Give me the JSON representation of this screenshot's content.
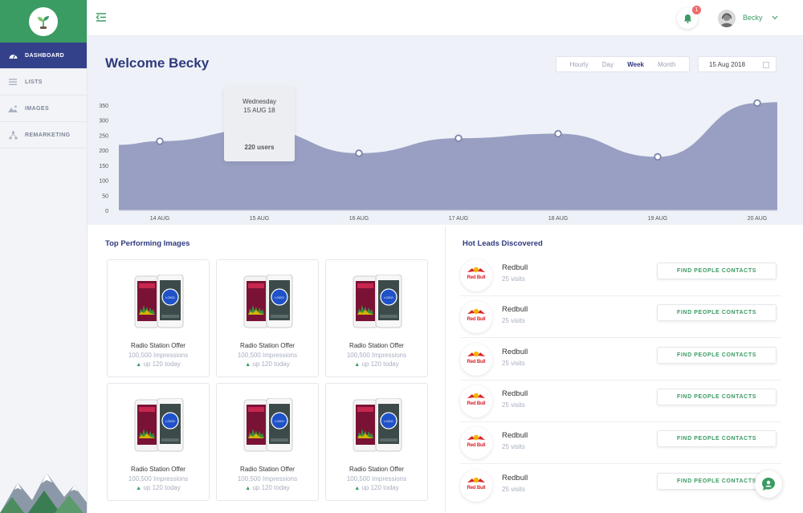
{
  "sidebar": {
    "items": [
      {
        "label": "DASHBOARD",
        "icon": "dashboard-icon",
        "active": true
      },
      {
        "label": "LISTS",
        "icon": "list-icon",
        "active": false
      },
      {
        "label": "IMAGES",
        "icon": "images-icon",
        "active": false
      },
      {
        "label": "REMARKETING",
        "icon": "remarketing-icon",
        "active": false
      }
    ]
  },
  "header": {
    "notification_count": "1",
    "user_name": "Becky"
  },
  "dashboard": {
    "welcome": "Welcome Becky",
    "range_tabs": [
      "Hourly",
      "Day",
      "Week",
      "Month"
    ],
    "active_range": "Week",
    "date": "15 Aug 2018"
  },
  "tooltip": {
    "day": "Wednesday",
    "date": "15 AUG 18",
    "value": "220 users"
  },
  "chart_data": {
    "type": "area",
    "categories": [
      "14 AUG",
      "15 AUG",
      "16 AUG",
      "17 AUG",
      "18 AUG",
      "19 AUG",
      "20 AUG"
    ],
    "values": [
      230,
      270,
      190,
      240,
      255,
      178,
      357
    ],
    "ylim": [
      0,
      350
    ],
    "yticks": [
      0,
      50,
      100,
      150,
      200,
      250,
      300,
      350
    ],
    "grid": false,
    "color": "#8a91b8"
  },
  "top_images": {
    "title": "Top Performing Images",
    "cards": [
      {
        "title": "Radio Station Offer",
        "impressions": "100,500 Impressions",
        "trend": "up 120 today"
      },
      {
        "title": "Radio Station Offer",
        "impressions": "100,500 Impressions",
        "trend": "up 120 today"
      },
      {
        "title": "Radio Station Offer",
        "impressions": "100,500 Impressions",
        "trend": "up 120 today"
      },
      {
        "title": "Radio Station Offer",
        "impressions": "100,500 Impressions",
        "trend": "up 120 today"
      },
      {
        "title": "Radio Station Offer",
        "impressions": "100,500 Impressions",
        "trend": "up 120 today"
      },
      {
        "title": "Radio Station Offer",
        "impressions": "100,500 Impressions",
        "trend": "up 120 today"
      }
    ],
    "phone_logo_text": "LOGO"
  },
  "hot_leads": {
    "title": "Hot Leads Discovered",
    "button_label": "FIND PEOPLE CONTACTS",
    "logo_text": "Red Bull",
    "leads": [
      {
        "name": "Redbull",
        "visits": "25 visits"
      },
      {
        "name": "Redbull",
        "visits": "25 visits"
      },
      {
        "name": "Redbull",
        "visits": "25 visits"
      },
      {
        "name": "Redbull",
        "visits": "25 visits"
      },
      {
        "name": "Redbull",
        "visits": "25 visits"
      },
      {
        "name": "Redbull",
        "visits": "25 visits"
      }
    ]
  },
  "colors": {
    "brand_green": "#3a9b63",
    "navy": "#2f3a7d",
    "sidebar_active": "#33408a",
    "chart_fill": "#8a91b8"
  }
}
